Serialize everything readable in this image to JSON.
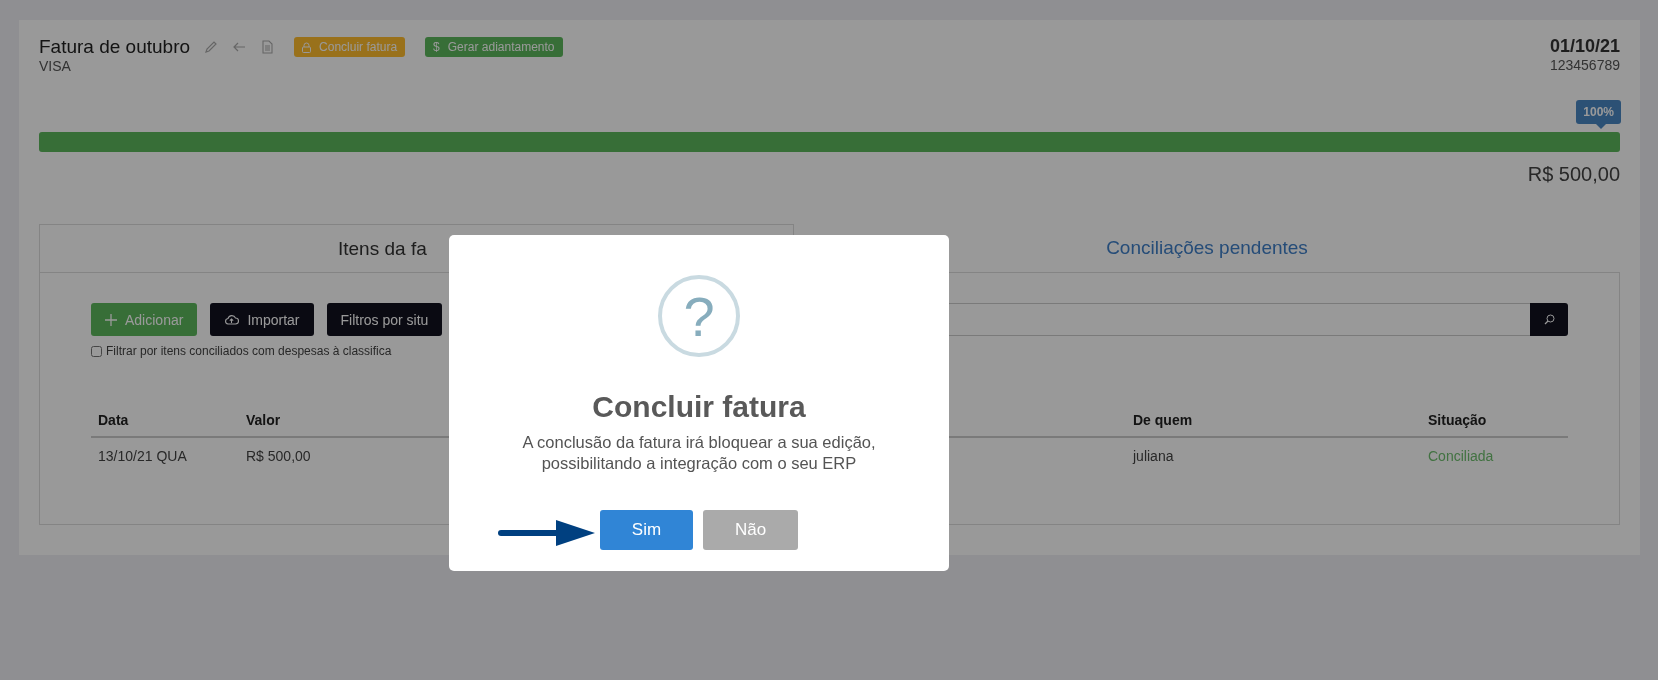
{
  "header": {
    "title": "Fatura de outubro",
    "subtitle": "VISA",
    "actions": [
      {
        "kind": "warning",
        "label": "Concluir fatura"
      },
      {
        "kind": "success",
        "symbol": "$",
        "label": "Gerar adiantamento"
      }
    ],
    "date": "01/10/21",
    "number": "123456789"
  },
  "progress": {
    "level": 1,
    "tooltip": "100%",
    "amount": "R$ 500,00"
  },
  "tabs": [
    {
      "label": "Itens da fa",
      "selected": true
    },
    {
      "label": "Conciliações pendentes",
      "selected": false
    }
  ],
  "toolbar": {
    "buttons": [
      {
        "kind": "add",
        "label": "Adicionar"
      },
      {
        "kind": "import",
        "label": "Importar"
      },
      {
        "kind": "filter",
        "label": "Filtros por situ"
      }
    ],
    "filter_checkbox": {
      "label": "Filtrar por itens conciliados com despesas à classifica",
      "checked": false
    }
  },
  "table": {
    "columns": [
      "Data",
      "Valor",
      "De quem",
      "Situação"
    ],
    "rows": [
      {
        "cells": [
          "13/10/21 QUA",
          "R$ 500,00",
          "juliana",
          "Conciliada"
        ]
      }
    ]
  },
  "dialog": {
    "icon_text": "?",
    "title": "Concluir fatura",
    "message": "A conclusão da fatura irá bloquear a sua edição, possibilitando a integração com o seu ERP",
    "buttons": [
      {
        "kind": "confirm",
        "label": "Sim"
      },
      {
        "kind": "cancel",
        "label": "Não"
      }
    ]
  }
}
